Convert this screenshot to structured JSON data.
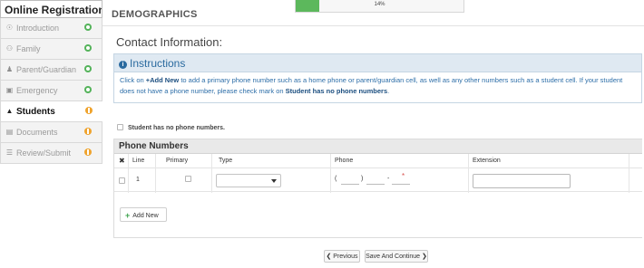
{
  "sidebar": {
    "title": "Online Registration",
    "items": [
      {
        "label": "Introduction",
        "icon": "lightbulb-icon",
        "glyph": "☉",
        "status": "done"
      },
      {
        "label": "Family",
        "icon": "family-icon",
        "glyph": "⚇",
        "status": "done"
      },
      {
        "label": "Parent/Guardian",
        "icon": "person-icon",
        "glyph": "♟",
        "status": "done"
      },
      {
        "label": "Emergency",
        "icon": "emergency-card-icon",
        "glyph": "▣",
        "status": "done"
      },
      {
        "label": "Students",
        "icon": "graduation-cap-icon",
        "glyph": "▲",
        "status": "warn"
      },
      {
        "label": "Documents",
        "icon": "document-icon",
        "glyph": "▤",
        "status": "warn"
      },
      {
        "label": "Review/Submit",
        "icon": "list-icon",
        "glyph": "☰",
        "status": "warn"
      }
    ]
  },
  "header": {
    "section": "DEMOGRAPHICS",
    "progress_label": "14%",
    "progress_value": 0.14
  },
  "contact_title": "Contact Information:",
  "instructions": {
    "title": "Instructions",
    "text_1": "Click on ",
    "bold_1": "+Add New",
    "text_2": " to add a primary phone number such as a home phone or parent/guardian cell, as well as any other numbers such as a student cell. If your student does not have a phone number, please check mark on ",
    "bold_2": "Student has no phone numbers",
    "text_3": "."
  },
  "no_phone_label": "Student has no phone numbers.",
  "phone_numbers": {
    "title": "Phone Numbers",
    "columns": {
      "delete": "✖",
      "line": "Line",
      "primary": "Primary",
      "type": "Type",
      "phone": "Phone",
      "extension": "Extension"
    },
    "rows": [
      {
        "line": "1",
        "type": "",
        "phone_open": "(",
        "phone_close": ")",
        "phone_dash": "-",
        "required": "*",
        "extension": ""
      }
    ],
    "add_new_label": "Add New"
  },
  "nav": {
    "previous_label": "❮ Previous",
    "save_label": "Save And Continue ❯"
  },
  "colors": {
    "progress_fill": "#5cb85c",
    "status_done": "#54b35a",
    "status_warn": "#efa32d",
    "instructions_accent": "#2a6a9f"
  }
}
